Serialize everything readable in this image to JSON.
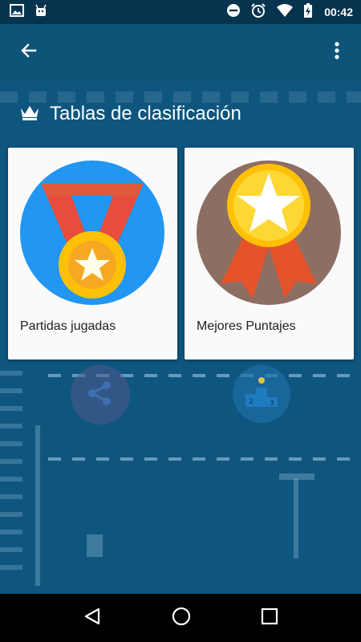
{
  "status_bar": {
    "time": "00:42",
    "left_icons": [
      "image-icon",
      "android-icon"
    ],
    "right_icons": [
      "do-not-disturb-icon",
      "alarm-icon",
      "wifi-icon",
      "battery-charging-icon"
    ]
  },
  "app_bar": {
    "back_icon": "arrow-back-icon",
    "menu_icon": "more-vert-icon"
  },
  "section": {
    "icon": "crown-icon",
    "title": "Tablas de clasificación"
  },
  "cards": [
    {
      "label": "Partidas jugadas",
      "icon": "medal-icon",
      "bg_color": "#2196f3"
    },
    {
      "label": "Mejores Puntajes",
      "icon": "award-ribbon-icon",
      "bg_color": "#8d6e63"
    }
  ],
  "nav_bar": {
    "icons": [
      "back-triangle-icon",
      "home-circle-icon",
      "recents-square-icon"
    ]
  },
  "colors": {
    "status_bar": "#06344f",
    "app_bar": "#0e5479",
    "background": "#0f567f",
    "card": "#fafafa"
  }
}
